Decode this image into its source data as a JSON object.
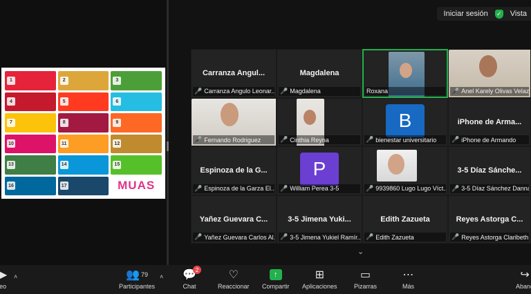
{
  "topbar": {
    "signin": "Iniciar sesión",
    "view": "Vista"
  },
  "sdg_logo": "MUAS",
  "sdg_cells": [
    {
      "num": "1",
      "color": "#e5243b"
    },
    {
      "num": "2",
      "color": "#dda63a"
    },
    {
      "num": "3",
      "color": "#4c9f38"
    },
    {
      "num": "4",
      "color": "#c5192d"
    },
    {
      "num": "5",
      "color": "#ff3a21"
    },
    {
      "num": "6",
      "color": "#26bde2"
    },
    {
      "num": "7",
      "color": "#fcc30b"
    },
    {
      "num": "8",
      "color": "#a21942"
    },
    {
      "num": "9",
      "color": "#fd6925"
    },
    {
      "num": "10",
      "color": "#dd1367"
    },
    {
      "num": "11",
      "color": "#fd9d24"
    },
    {
      "num": "12",
      "color": "#bf8b2e"
    },
    {
      "num": "13",
      "color": "#3f7e44"
    },
    {
      "num": "14",
      "color": "#0a97d9"
    },
    {
      "num": "15",
      "color": "#56c02b"
    },
    {
      "num": "16",
      "color": "#00689d"
    },
    {
      "num": "17",
      "color": "#19486a"
    }
  ],
  "participants": [
    {
      "center": "Carranza  Angul...",
      "label": "Carranza Angulo Leonar...",
      "muted": true
    },
    {
      "center": "Magdalena",
      "label": "Magdalena",
      "muted": true
    },
    {
      "center": "",
      "label": "Roxana",
      "muted": false,
      "video": true,
      "active": true
    },
    {
      "center": "",
      "label": "Anel Karely Olivas Velaz...",
      "muted": true,
      "video": true
    },
    {
      "center": "",
      "label": "Fernando Rodriguez",
      "muted": true,
      "video": true
    },
    {
      "center": "",
      "label": "Cinthia Reyna",
      "muted": true,
      "video": true
    },
    {
      "center": "",
      "letter": "B",
      "letter_color": "#1769c2",
      "label": "bienestar universitario",
      "muted": true
    },
    {
      "center": "iPhone de Arma...",
      "label": "iPhone de Armando",
      "muted": true
    },
    {
      "center": "Espinoza de la G...",
      "label": "Espinoza de la Garza El...",
      "muted": true
    },
    {
      "center": "",
      "letter": "P",
      "letter_color": "#6b3fd1",
      "label": "William Perea 3-5",
      "muted": true
    },
    {
      "center": "",
      "label": "9939860 Lugo Lugo Víct...",
      "muted": true,
      "video": true
    },
    {
      "center": "3-5 Díaz Sánche...",
      "label": "3-5 Díaz Sánchez Danna...",
      "muted": true
    },
    {
      "center": "Yañez Guevara C...",
      "label": "Yañez Guevara Carlos Al...",
      "muted": true
    },
    {
      "center": "3-5 Jimena Yuki...",
      "label": "3-5 Jimena Yukiel Ramír...",
      "muted": true
    },
    {
      "center": "Edith Zazueta",
      "label": "Edith Zazueta",
      "muted": true
    },
    {
      "center": "Reyes Astorga C...",
      "label": "Reyes Astorga Claribeth",
      "muted": true
    }
  ],
  "toolbar": {
    "video": "eo",
    "participants": "Participantes",
    "participants_count": "79",
    "chat": "Chat",
    "chat_badge": "2",
    "reactions": "Reaccionar",
    "share": "Compartir",
    "apps": "Aplicaciones",
    "whiteboards": "Pizarras",
    "more": "Más",
    "leave": "Aband"
  }
}
